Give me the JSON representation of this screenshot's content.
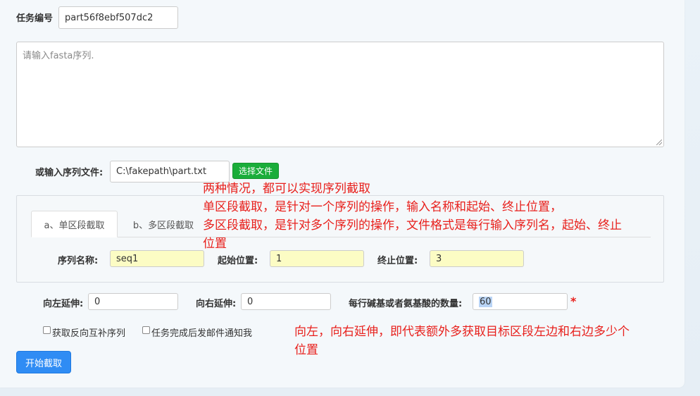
{
  "task": {
    "label": "任务编号",
    "value": "part56f8ebf507dc2"
  },
  "fasta": {
    "placeholder": "请输入fasta序列."
  },
  "file": {
    "label": "或输入序列文件:",
    "path": "C:\\fakepath\\part.txt",
    "button": "选择文件"
  },
  "notes": {
    "top_lines": [
      "两种情况，都可以实现序列截取",
      "单区段截取，是针对一个序列的操作，输入名称和起始、终止位置，",
      "多区段截取，是针对多个序列的操作，文件格式是每行输入序列名，起始、终止",
      "位置"
    ],
    "bottom_lines": [
      "向左，向右延伸，即代表额外多获取目标区段左边和右边多少个",
      "位置"
    ]
  },
  "tabs": [
    {
      "label": "a、单区段截取",
      "active": true
    },
    {
      "label": "b、多区段截取",
      "active": false
    }
  ],
  "single": {
    "name_label": "序列名称:",
    "name_value": "seq1",
    "start_label": "起始位置:",
    "start_value": "1",
    "end_label": "终止位置:",
    "end_value": "3"
  },
  "extend": {
    "left_label": "向左延伸:",
    "left_value": "0",
    "right_label": "向右延伸:",
    "right_value": "0",
    "per_line_label": "每行碱基或者氨基酸的数量:",
    "per_line_value": "60",
    "required_mark": "*"
  },
  "options": [
    {
      "label": "获取反向互补序列",
      "checked": false
    },
    {
      "label": "任务完成后发邮件通知我",
      "checked": false
    }
  ],
  "submit": {
    "label": "开始截取"
  },
  "colors": {
    "accent_blue": "#2f8cf4",
    "file_button_green": "#1aad3a",
    "note_red": "#e8201c",
    "input_highlight": "#fcfcc4"
  }
}
